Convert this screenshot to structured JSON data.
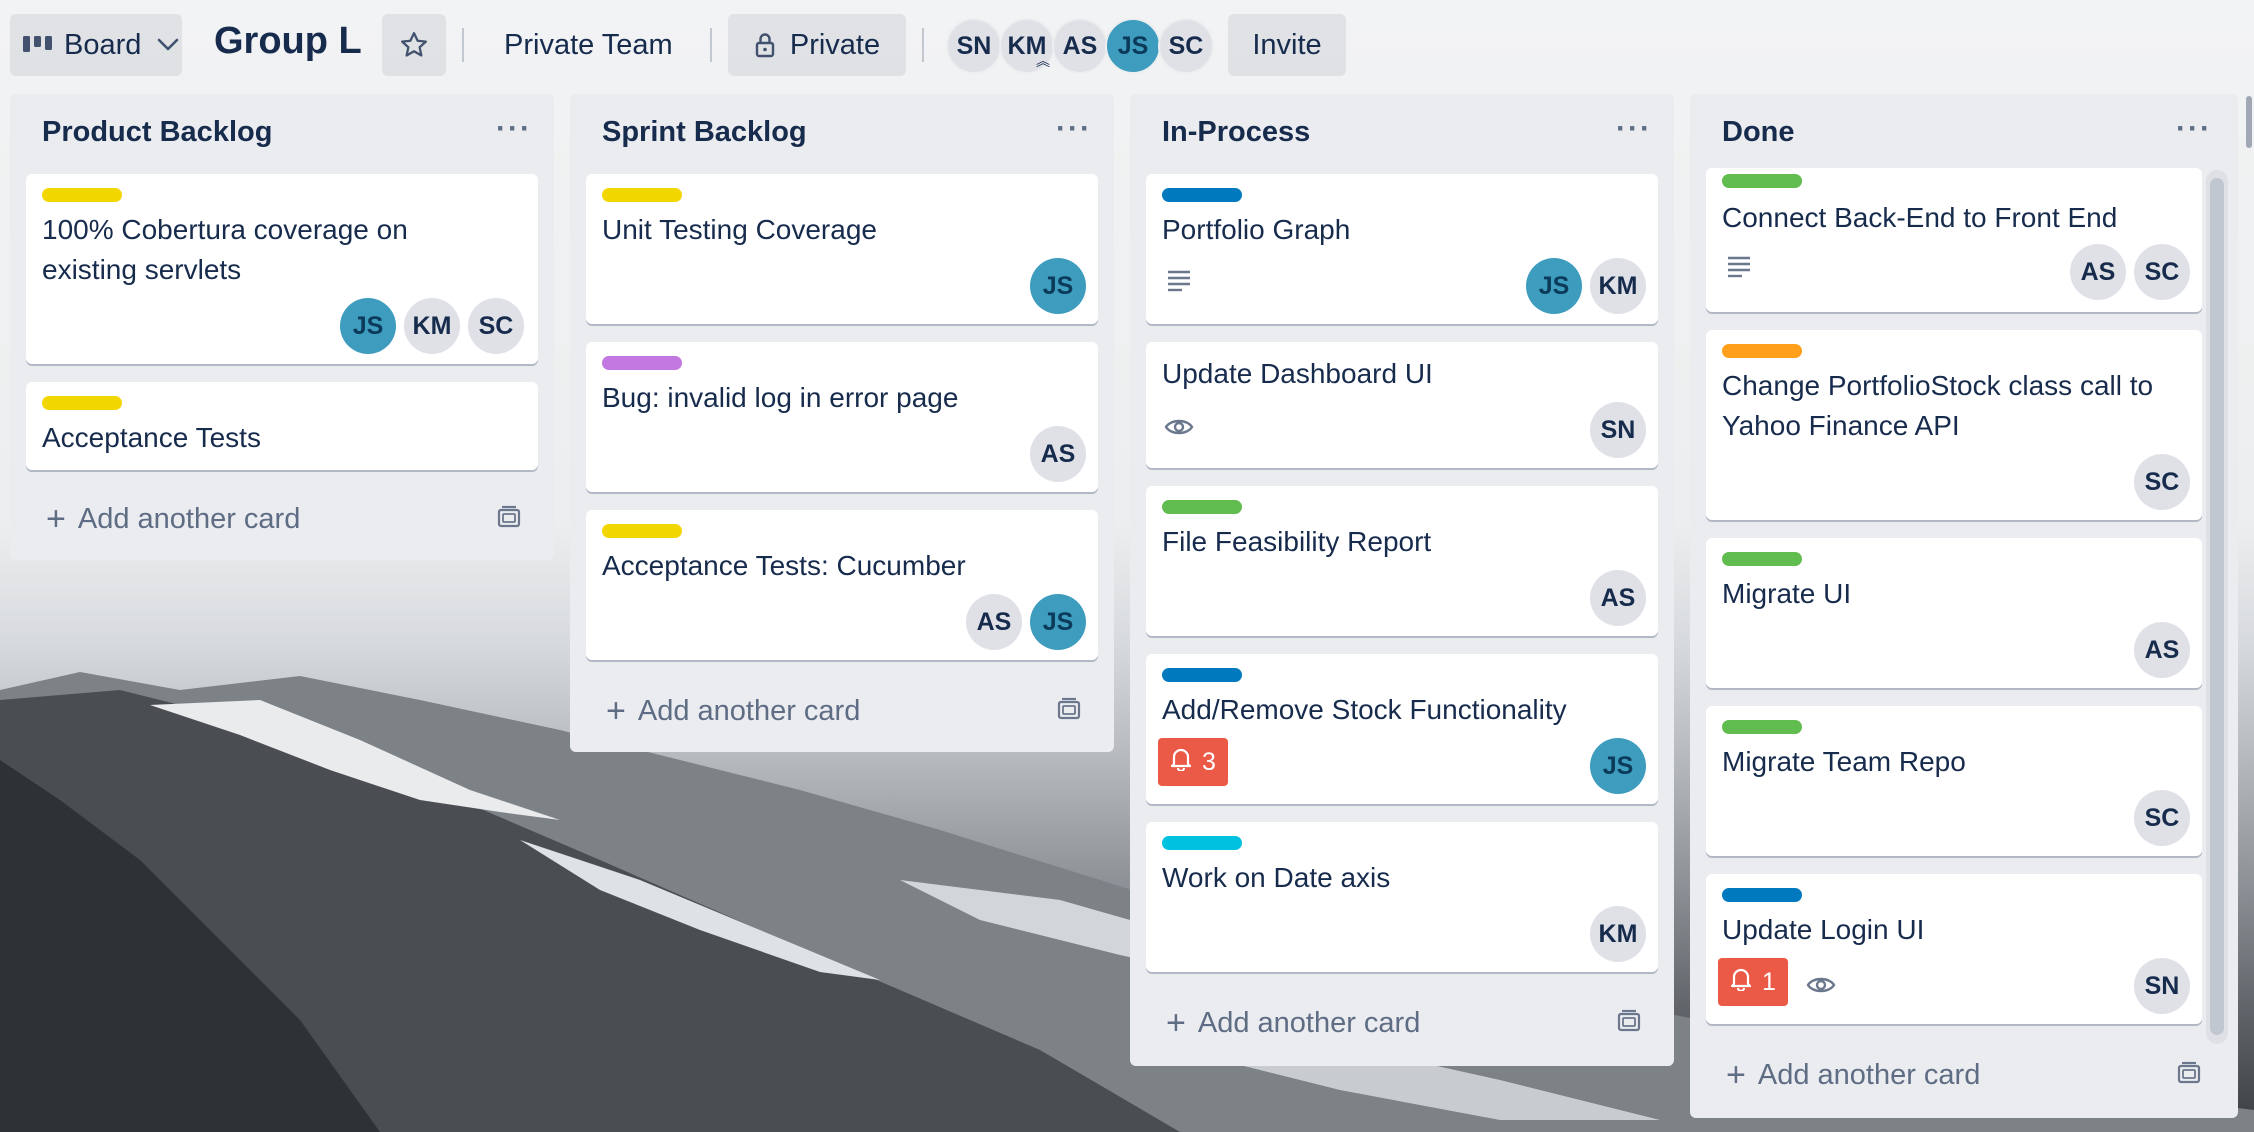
{
  "header": {
    "board_switcher_label": "Board",
    "board_title": "Group L",
    "team_label": "Private Team",
    "visibility_label": "Private",
    "invite_label": "Invite",
    "members": [
      "SN",
      "KM",
      "AS",
      "JS",
      "SC"
    ]
  },
  "colors": {
    "yellow": "#f2d600",
    "purple": "#c377e0",
    "blue": "#0079bf",
    "green": "#61bd4f",
    "orange": "#ff9f1a",
    "sky": "#00c2e0",
    "red": "#eb5a46",
    "avatar_blue": "#3e9cbf"
  },
  "lists": [
    {
      "title": "Product Backlog",
      "add_label": "Add another card",
      "cards": [
        {
          "title_line1": "100% Cobertura coverage on",
          "title_line2": "existing servlets",
          "label": "yellow",
          "members": [
            "JS",
            "KM",
            "SC"
          ]
        },
        {
          "title": "Acceptance Tests",
          "label": "yellow",
          "members": []
        }
      ]
    },
    {
      "title": "Sprint Backlog",
      "add_label": "Add another card",
      "cards": [
        {
          "title": "Unit Testing Coverage",
          "label": "yellow",
          "members": [
            "JS"
          ]
        },
        {
          "title": "Bug: invalid log in error page",
          "label": "purple",
          "members": [
            "AS"
          ]
        },
        {
          "title": "Acceptance Tests: Cucumber",
          "label": "yellow",
          "members": [
            "AS",
            "JS"
          ]
        }
      ]
    },
    {
      "title": "In-Process",
      "add_label": "Add another card",
      "cards": [
        {
          "title": "Portfolio Graph",
          "label": "blue",
          "badges": [
            "description-icon"
          ],
          "members": [
            "JS",
            "KM"
          ]
        },
        {
          "title": "Update Dashboard UI",
          "badges": [
            "watch-icon"
          ],
          "members": [
            "SN"
          ]
        },
        {
          "title": "File Feasibility Report",
          "label": "green",
          "members": [
            "AS"
          ]
        },
        {
          "title": "Add/Remove Stock Functionality",
          "label": "blue",
          "notification_count": "3",
          "members": [
            "JS"
          ]
        },
        {
          "title": "Work on Date axis",
          "label": "sky",
          "members": [
            "KM"
          ]
        }
      ]
    },
    {
      "title": "Done",
      "add_label": "Add another card",
      "cards": [
        {
          "title": "Connect Back-End to Front End",
          "label": "green",
          "badges": [
            "description-icon"
          ],
          "members": [
            "AS",
            "SC"
          ]
        },
        {
          "title_line1": "Change PortfolioStock class call to",
          "title_line2": "Yahoo Finance API",
          "label": "orange",
          "members": [
            "SC"
          ]
        },
        {
          "title": "Migrate UI",
          "label": "green",
          "members": [
            "AS"
          ]
        },
        {
          "title": "Migrate Team Repo",
          "label": "green",
          "members": [
            "SC"
          ]
        },
        {
          "title": "Update Login UI",
          "label": "blue",
          "notification_count": "1",
          "badges": [
            "watch-icon"
          ],
          "members": [
            "SN"
          ]
        }
      ]
    }
  ]
}
